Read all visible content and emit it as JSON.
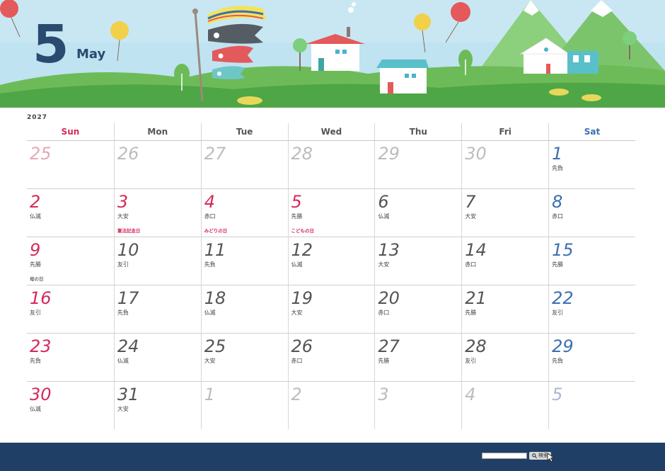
{
  "header": {
    "month_number": "5",
    "month_name": "May"
  },
  "calendar": {
    "year": "2027",
    "weekdays": [
      "Sun",
      "Mon",
      "Tue",
      "Wed",
      "Thu",
      "Fri",
      "Sat"
    ],
    "weeks": [
      [
        {
          "day": "25",
          "rokuyo": "",
          "holiday": "",
          "other": true
        },
        {
          "day": "26",
          "rokuyo": "",
          "holiday": "",
          "other": true
        },
        {
          "day": "27",
          "rokuyo": "",
          "holiday": "",
          "other": true
        },
        {
          "day": "28",
          "rokuyo": "",
          "holiday": "",
          "other": true
        },
        {
          "day": "29",
          "rokuyo": "",
          "holiday": "",
          "other": true
        },
        {
          "day": "30",
          "rokuyo": "",
          "holiday": "",
          "other": true
        },
        {
          "day": "1",
          "rokuyo": "先負",
          "holiday": "",
          "other": false
        }
      ],
      [
        {
          "day": "2",
          "rokuyo": "仏滅",
          "holiday": "",
          "other": false
        },
        {
          "day": "3",
          "rokuyo": "大安",
          "holiday": "憲法記念日",
          "other": false,
          "red": true
        },
        {
          "day": "4",
          "rokuyo": "赤口",
          "holiday": "みどりの日",
          "other": false,
          "red": true
        },
        {
          "day": "5",
          "rokuyo": "先勝",
          "holiday": "こどもの日",
          "other": false,
          "red": true
        },
        {
          "day": "6",
          "rokuyo": "仏滅",
          "holiday": "",
          "other": false
        },
        {
          "day": "7",
          "rokuyo": "大安",
          "holiday": "",
          "other": false
        },
        {
          "day": "8",
          "rokuyo": "赤口",
          "holiday": "",
          "other": false
        }
      ],
      [
        {
          "day": "9",
          "rokuyo": "先勝",
          "holiday": "母の日",
          "other": false,
          "note": true
        },
        {
          "day": "10",
          "rokuyo": "友引",
          "holiday": "",
          "other": false
        },
        {
          "day": "11",
          "rokuyo": "先負",
          "holiday": "",
          "other": false
        },
        {
          "day": "12",
          "rokuyo": "仏滅",
          "holiday": "",
          "other": false
        },
        {
          "day": "13",
          "rokuyo": "大安",
          "holiday": "",
          "other": false
        },
        {
          "day": "14",
          "rokuyo": "赤口",
          "holiday": "",
          "other": false
        },
        {
          "day": "15",
          "rokuyo": "先勝",
          "holiday": "",
          "other": false
        }
      ],
      [
        {
          "day": "16",
          "rokuyo": "友引",
          "holiday": "",
          "other": false
        },
        {
          "day": "17",
          "rokuyo": "先負",
          "holiday": "",
          "other": false
        },
        {
          "day": "18",
          "rokuyo": "仏滅",
          "holiday": "",
          "other": false
        },
        {
          "day": "19",
          "rokuyo": "大安",
          "holiday": "",
          "other": false
        },
        {
          "day": "20",
          "rokuyo": "赤口",
          "holiday": "",
          "other": false
        },
        {
          "day": "21",
          "rokuyo": "先勝",
          "holiday": "",
          "other": false
        },
        {
          "day": "22",
          "rokuyo": "友引",
          "holiday": "",
          "other": false
        }
      ],
      [
        {
          "day": "23",
          "rokuyo": "先負",
          "holiday": "",
          "other": false
        },
        {
          "day": "24",
          "rokuyo": "仏滅",
          "holiday": "",
          "other": false
        },
        {
          "day": "25",
          "rokuyo": "大安",
          "holiday": "",
          "other": false
        },
        {
          "day": "26",
          "rokuyo": "赤口",
          "holiday": "",
          "other": false
        },
        {
          "day": "27",
          "rokuyo": "先勝",
          "holiday": "",
          "other": false
        },
        {
          "day": "28",
          "rokuyo": "友引",
          "holiday": "",
          "other": false
        },
        {
          "day": "29",
          "rokuyo": "先負",
          "holiday": "",
          "other": false
        }
      ],
      [
        {
          "day": "30",
          "rokuyo": "仏滅",
          "holiday": "",
          "other": false
        },
        {
          "day": "31",
          "rokuyo": "大安",
          "holiday": "",
          "other": false
        },
        {
          "day": "1",
          "rokuyo": "",
          "holiday": "",
          "other": true
        },
        {
          "day": "2",
          "rokuyo": "",
          "holiday": "",
          "other": true
        },
        {
          "day": "3",
          "rokuyo": "",
          "holiday": "",
          "other": true
        },
        {
          "day": "4",
          "rokuyo": "",
          "holiday": "",
          "other": true
        },
        {
          "day": "5",
          "rokuyo": "",
          "holiday": "",
          "other": true
        }
      ]
    ]
  },
  "footer": {
    "search_button_label": "検索",
    "search_value": ""
  },
  "colors": {
    "sunday_red": "#d42a5a",
    "saturday_blue": "#3b6fb0",
    "footer_navy": "#1f3f66",
    "title_navy": "#2a4a70"
  }
}
